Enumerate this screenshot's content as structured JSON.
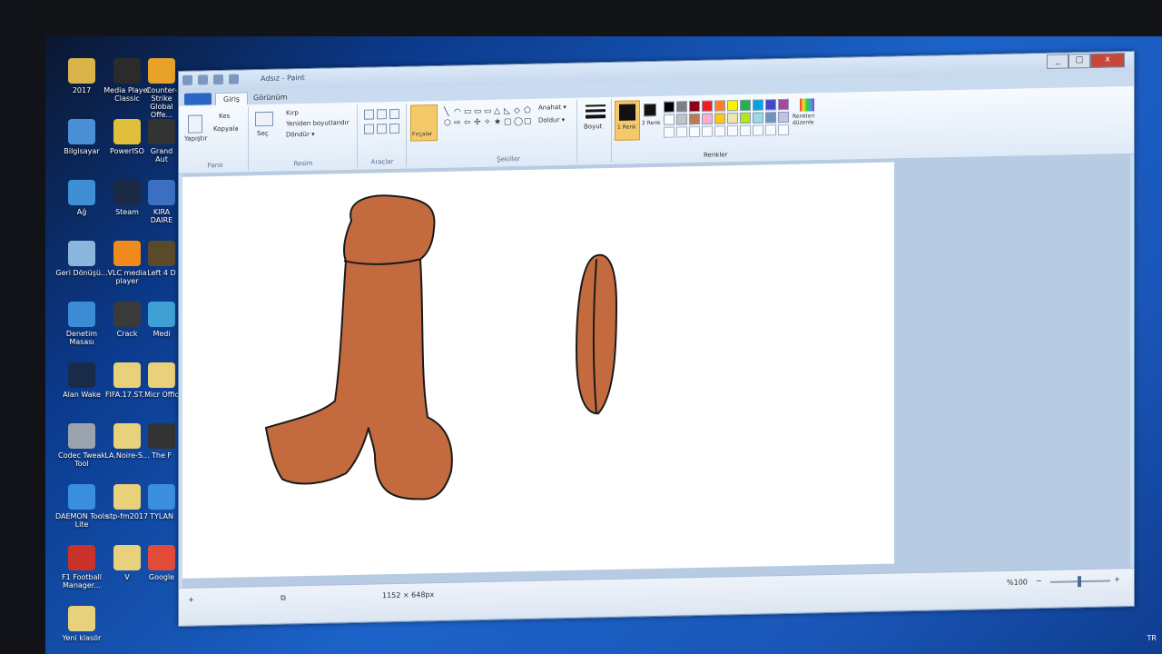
{
  "desktop": {
    "icons": [
      {
        "label": "2017",
        "color": "#d9b44a"
      },
      {
        "label": "Media Player Classic",
        "color": "#2b2b2b"
      },
      {
        "label": "Counter-Strike Global Offe...",
        "color": "#e8a22a"
      },
      {
        "label": "Bilgisayar",
        "color": "#4a8ed6"
      },
      {
        "label": "PowerISO",
        "color": "#e0c03a"
      },
      {
        "label": "Grand Aut",
        "color": "#333"
      },
      {
        "label": "Ağ",
        "color": "#3f8fd6"
      },
      {
        "label": "Steam",
        "color": "#1b2a44"
      },
      {
        "label": "KIRA DAIRE",
        "color": "#3a6fc2"
      },
      {
        "label": "Geri Dönüşü...",
        "color": "#8ab6dc"
      },
      {
        "label": "VLC media player",
        "color": "#f08a1a"
      },
      {
        "label": "Left 4 D",
        "color": "#5a4a2a"
      },
      {
        "label": "Denetim Masası",
        "color": "#3b8bd6"
      },
      {
        "label": "Crack",
        "color": "#3a3a3a"
      },
      {
        "label": "Medi",
        "color": "#3fa0d6"
      },
      {
        "label": "Alan Wake",
        "color": "#1a2b4a"
      },
      {
        "label": "FIFA.17.ST...",
        "color": "#e9d07a"
      },
      {
        "label": "Micr Offic",
        "color": "#e9d07a"
      },
      {
        "label": "Codec Tweak Tool",
        "color": "#9aa3ad"
      },
      {
        "label": "LA.Noire-S...",
        "color": "#e9d07a"
      },
      {
        "label": "The F",
        "color": "#333"
      },
      {
        "label": "DAEMON Tools Lite",
        "color": "#3a8ee0"
      },
      {
        "label": "stp-fm2017",
        "color": "#e9d07a"
      },
      {
        "label": "TYLAN",
        "color": "#3a8ee0"
      },
      {
        "label": "F1 Football Manager...",
        "color": "#c9322a"
      },
      {
        "label": "V",
        "color": "#e9d07a"
      },
      {
        "label": "Google",
        "color": "#e24a3a"
      },
      {
        "label": "Yeni klasör",
        "color": "#e9d07a"
      }
    ]
  },
  "window": {
    "title": "Adsız - Paint",
    "tabs": [
      "Giriş",
      "Görünüm"
    ],
    "help": "?",
    "controls": {
      "minimize": "_",
      "maximize": "□",
      "close": "x"
    }
  },
  "ribbon": {
    "pano": {
      "paste": "Yapıştır",
      "cut": "Kes",
      "copy": "Kopyala",
      "label": "Pano"
    },
    "resim": {
      "select": "Seç",
      "crop": "Kırp",
      "resize": "Yeniden boyutlandır",
      "rotate": "Döndür ▾",
      "label": "Resim"
    },
    "araclar": {
      "label": "Araçlar"
    },
    "brushes": {
      "label": "Fırçalar"
    },
    "sekiller": {
      "outline": "Anahat ▾",
      "fill": "Doldur ▾",
      "label": "Şekiller"
    },
    "size": {
      "label": "Boyut"
    },
    "colors": {
      "color1": "1 Renk",
      "color2": "2 Renk",
      "edit": "Renkleri düzenle",
      "label": "Renkler",
      "palette_row1": [
        "#000000",
        "#7f7f7f",
        "#880015",
        "#ed1c24",
        "#ff7f27",
        "#fff200",
        "#22b14c",
        "#00a2e8",
        "#3f48cc",
        "#a349a4"
      ],
      "palette_row2": [
        "#ffffff",
        "#c3c3c3",
        "#b97a57",
        "#ffaec9",
        "#ffc90e",
        "#efe4b0",
        "#b5e61d",
        "#99d9ea",
        "#7092be",
        "#c8bfe7"
      ]
    }
  },
  "drawing": {
    "fill": "#c36b3f",
    "stroke": "#1a1a1a"
  },
  "status": {
    "size": "1152 × 648px",
    "zoom": "%100",
    "minus": "−",
    "plus": "+"
  },
  "taskbar": {
    "lang": "TR"
  }
}
